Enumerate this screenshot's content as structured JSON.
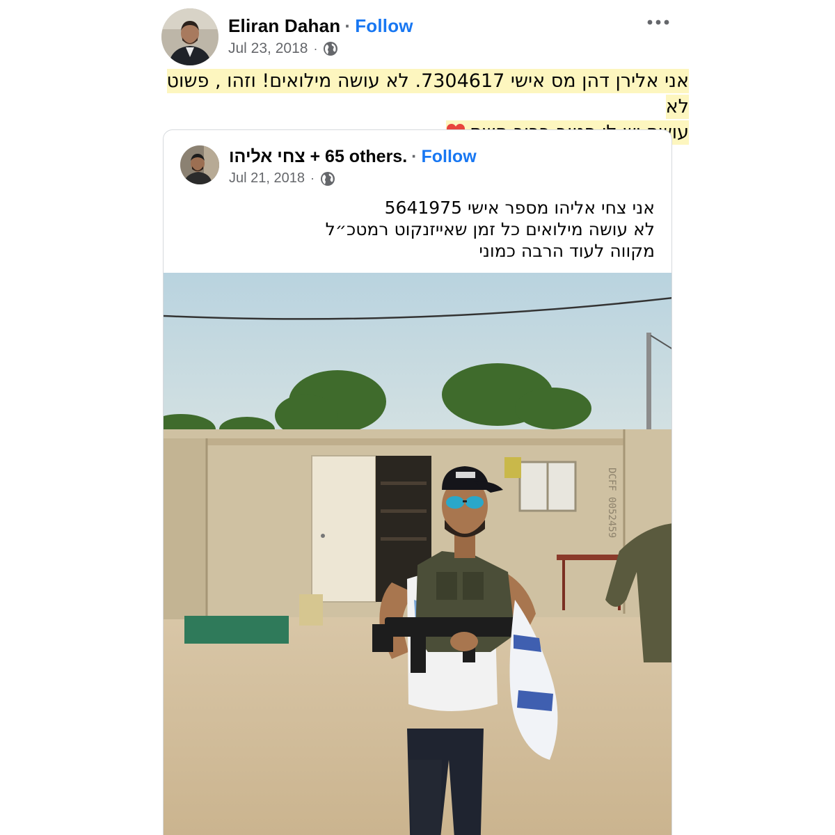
{
  "post": {
    "author": "Eliran Dahan",
    "follow_label": "Follow",
    "separator": "·",
    "date": "Jul 23, 2018",
    "text_line1": "אני אלירן דהן מס אישי 7304617. לא עושה מילואים! וזהו , פשוט לא",
    "text_line2": "עושה יש לי פטור ברוך השם",
    "privacy_icon": "globe-icon",
    "menu_icon": "more-horizontal-icon",
    "highlight_color": "#fdf6bf"
  },
  "shared_post": {
    "author": "צחי אליהו",
    "author_suffix": "+ 65 others.",
    "follow_label": "Follow",
    "separator": "·",
    "date": "Jul 21, 2018",
    "privacy_icon": "globe-icon",
    "text_lines": [
      "אני צחי אליהו מספר אישי 5641975",
      "לא עושה מילואים כל זמן שאייזנקוט רמטכ״ל",
      "מקווה לעוד הרבה כמוני"
    ]
  },
  "colors": {
    "link_blue": "#1877f2",
    "secondary_text": "#65676b",
    "heart_red": "#e8453c"
  }
}
